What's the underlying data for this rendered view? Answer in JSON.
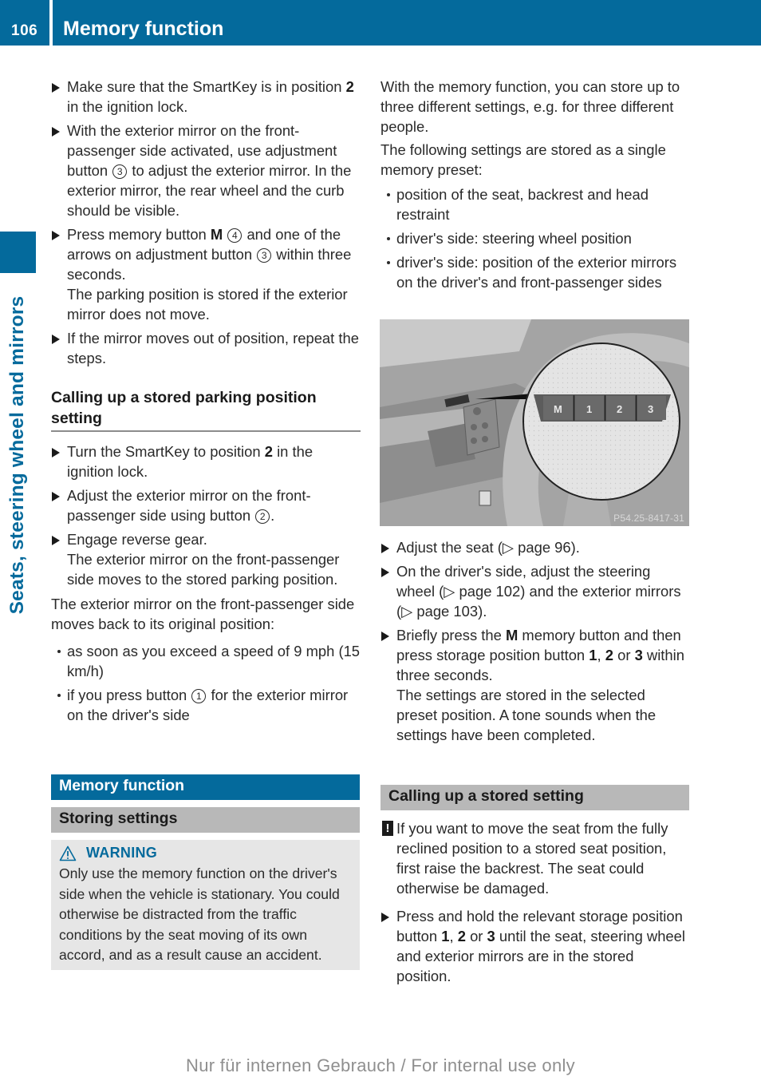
{
  "header": {
    "page_number": "106",
    "title": "Memory function"
  },
  "sidebar": {
    "chapter_label": "Seats, steering wheel and mirrors"
  },
  "left_column": {
    "steps_top": [
      {
        "parts": [
          "Make sure that the SmartKey is in position ",
          {
            "b": "2"
          },
          " in the ignition lock."
        ]
      },
      {
        "parts": [
          "With the exterior mirror on the front-passenger side activated, use adjustment button ",
          {
            "c": "3"
          },
          " to adjust the exterior mirror. In the exterior mirror, the rear wheel and the curb should be visible."
        ]
      },
      {
        "parts": [
          "Press memory button ",
          {
            "b": "M"
          },
          " ",
          {
            "c": "4"
          },
          " and one of the arrows on adjustment button ",
          {
            "c": "3"
          },
          " within three seconds."
        ],
        "result": "The parking position is stored if the exterior mirror does not move."
      },
      {
        "parts": [
          "If the mirror moves out of position, repeat the steps."
        ]
      }
    ],
    "subheading": "Calling up a stored parking position setting",
    "steps_parking": [
      {
        "parts": [
          "Turn the SmartKey to position ",
          {
            "b": "2"
          },
          " in the ignition lock."
        ]
      },
      {
        "parts": [
          "Adjust the exterior mirror on the front-passenger side using button ",
          {
            "c": "2"
          },
          "."
        ]
      },
      {
        "parts": [
          "Engage reverse gear."
        ],
        "result": "The exterior mirror on the front-passenger side moves to the stored parking position."
      }
    ],
    "return_intro": "The exterior mirror on the front-passenger side moves back to its original position:",
    "return_bullets": [
      {
        "parts": [
          "as soon as you exceed a speed of 9 mph (15 km/h)"
        ]
      },
      {
        "parts": [
          "if you press button ",
          {
            "c": "1"
          },
          " for the exterior mirror on the driver's side"
        ]
      }
    ],
    "section_title": "Memory function",
    "subsection_title": "Storing settings",
    "warning": {
      "icon": "warning-triangle-icon",
      "label": "WARNING",
      "text": "Only use the memory function on the driver's side when the vehicle is stationary. You could otherwise be distracted from the traffic conditions by the seat moving of its own accord, and as a result cause an accident."
    }
  },
  "right_column": {
    "intro_1": "With the memory function, you can store up to three different settings, e.g. for three different people.",
    "intro_2": "The following settings are stored as a single memory preset:",
    "stored_bullets": [
      {
        "parts": [
          "position of the seat, backrest and head restraint"
        ]
      },
      {
        "parts": [
          "driver's side: steering wheel position"
        ]
      },
      {
        "parts": [
          "driver's side: position of the exterior mirrors on the driver's and front-passenger sides"
        ]
      }
    ],
    "figure": {
      "buttons": [
        "M",
        "1",
        "2",
        "3"
      ],
      "code": "P54.25-8417-31"
    },
    "steps_store": [
      {
        "parts": [
          "Adjust the seat (▷ page 96)."
        ]
      },
      {
        "parts": [
          "On the driver's side, adjust the steering wheel (▷ page 102) and the exterior mirrors (▷ page 103)."
        ]
      },
      {
        "parts": [
          "Briefly press the ",
          {
            "b": "M"
          },
          " memory button and then press storage position button ",
          {
            "b": "1"
          },
          ", ",
          {
            "b": "2"
          },
          " or ",
          {
            "b": "3"
          },
          " within three seconds."
        ],
        "result": "The settings are stored in the selected preset position. A tone sounds when the settings have been completed."
      }
    ],
    "subsection_title": "Calling up a stored setting",
    "note": {
      "icon": "exclamation-icon",
      "symbol": "!",
      "text": "If you want to move the seat from the fully reclined position to a stored seat position, first raise the backrest. The seat could otherwise be damaged."
    },
    "steps_recall": [
      {
        "parts": [
          "Press and hold the relevant storage position button ",
          {
            "b": "1"
          },
          ", ",
          {
            "b": "2"
          },
          " or ",
          {
            "b": "3"
          },
          " until the seat, steering wheel and exterior mirrors are in the stored position."
        ]
      }
    ]
  },
  "footer": {
    "watermark": "Nur für internen Gebrauch / For internal use only"
  }
}
